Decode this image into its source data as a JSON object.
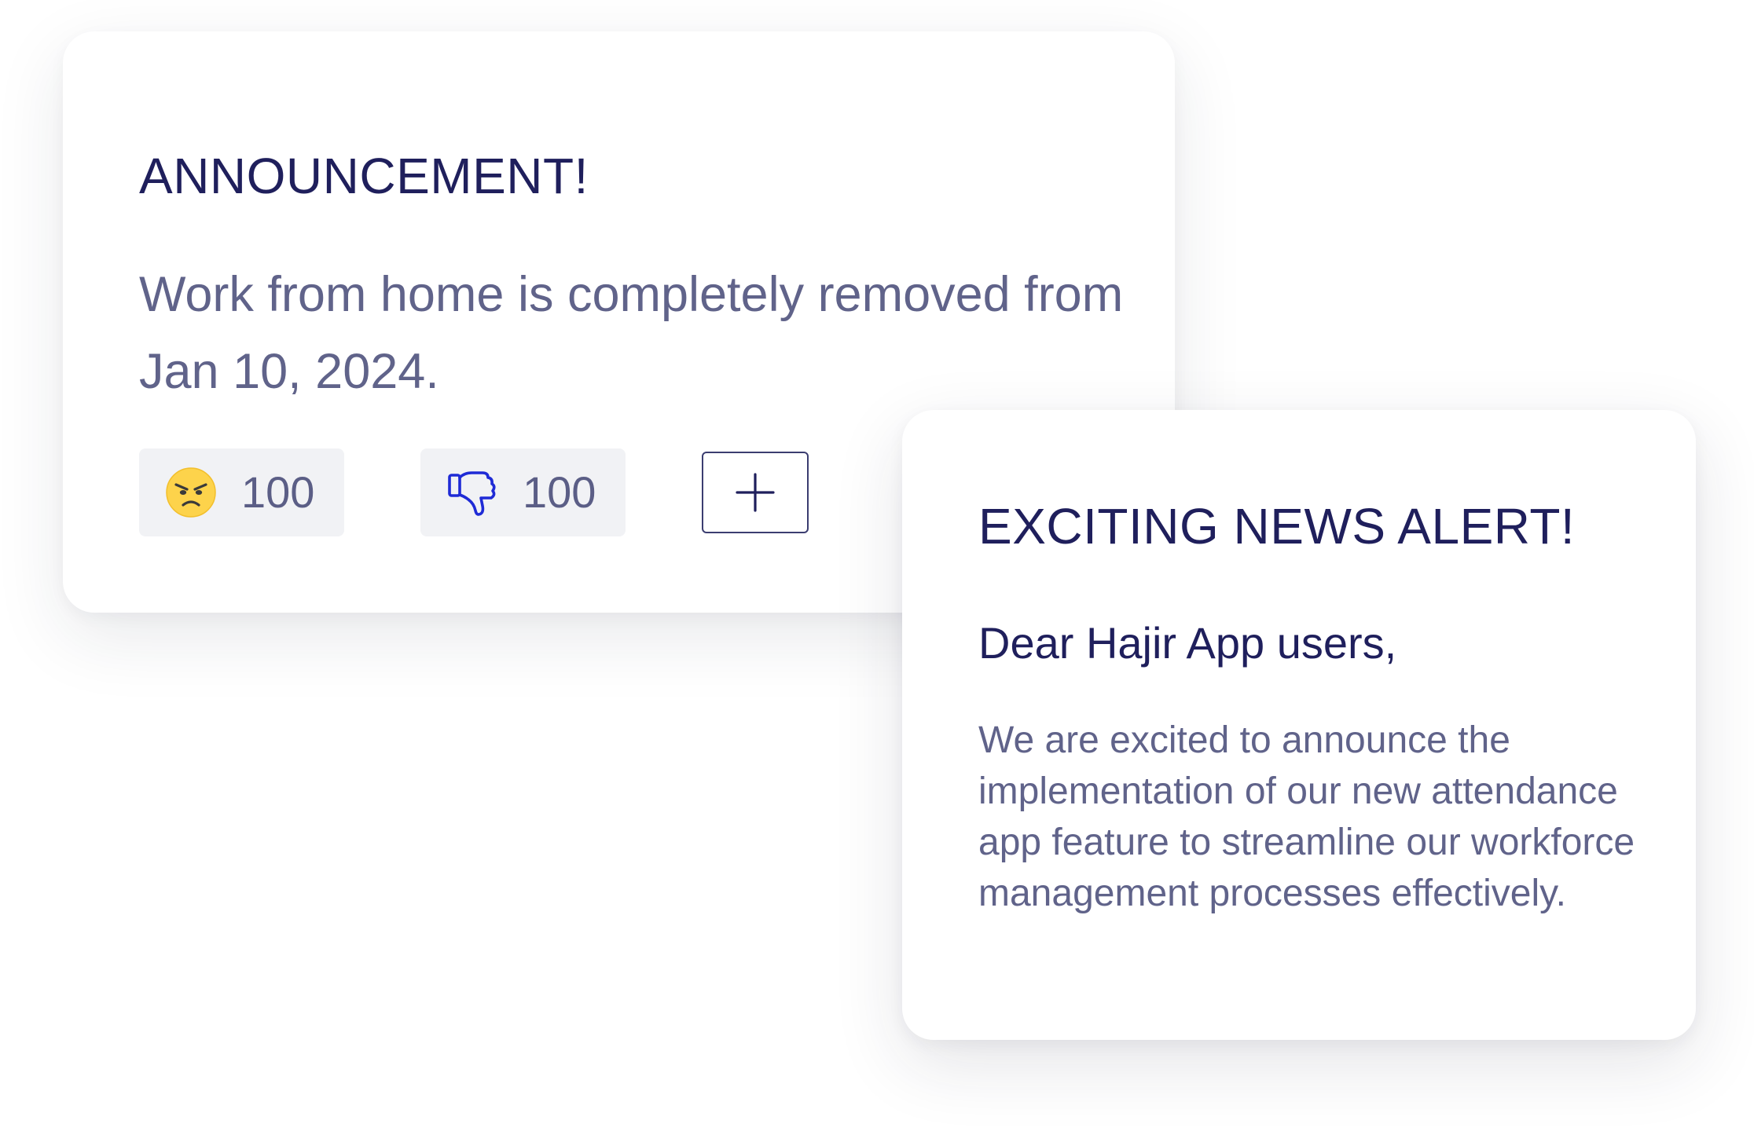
{
  "announcement": {
    "title": "ANNOUNCEMENT!",
    "body": "Work from home is completely removed from Jan 10, 2024.",
    "reactions": [
      {
        "icon": "angry-face-icon",
        "count": "100"
      },
      {
        "icon": "thumbs-down-icon",
        "count": "100"
      }
    ],
    "add_reaction_icon": "plus-icon"
  },
  "news": {
    "title": "EXCITING NEWS ALERT!",
    "greeting": "Dear Hajir App users,",
    "body": "We are excited to announce the implementation of our new attendance app feature to streamline our workforce management processes effectively."
  },
  "colors": {
    "title": "#1f1f5c",
    "body_text": "#60638a",
    "pill_background": "#f1f2f5",
    "thumbs_down": "#1f2bd6",
    "emoji_face": "#fdd34b"
  }
}
